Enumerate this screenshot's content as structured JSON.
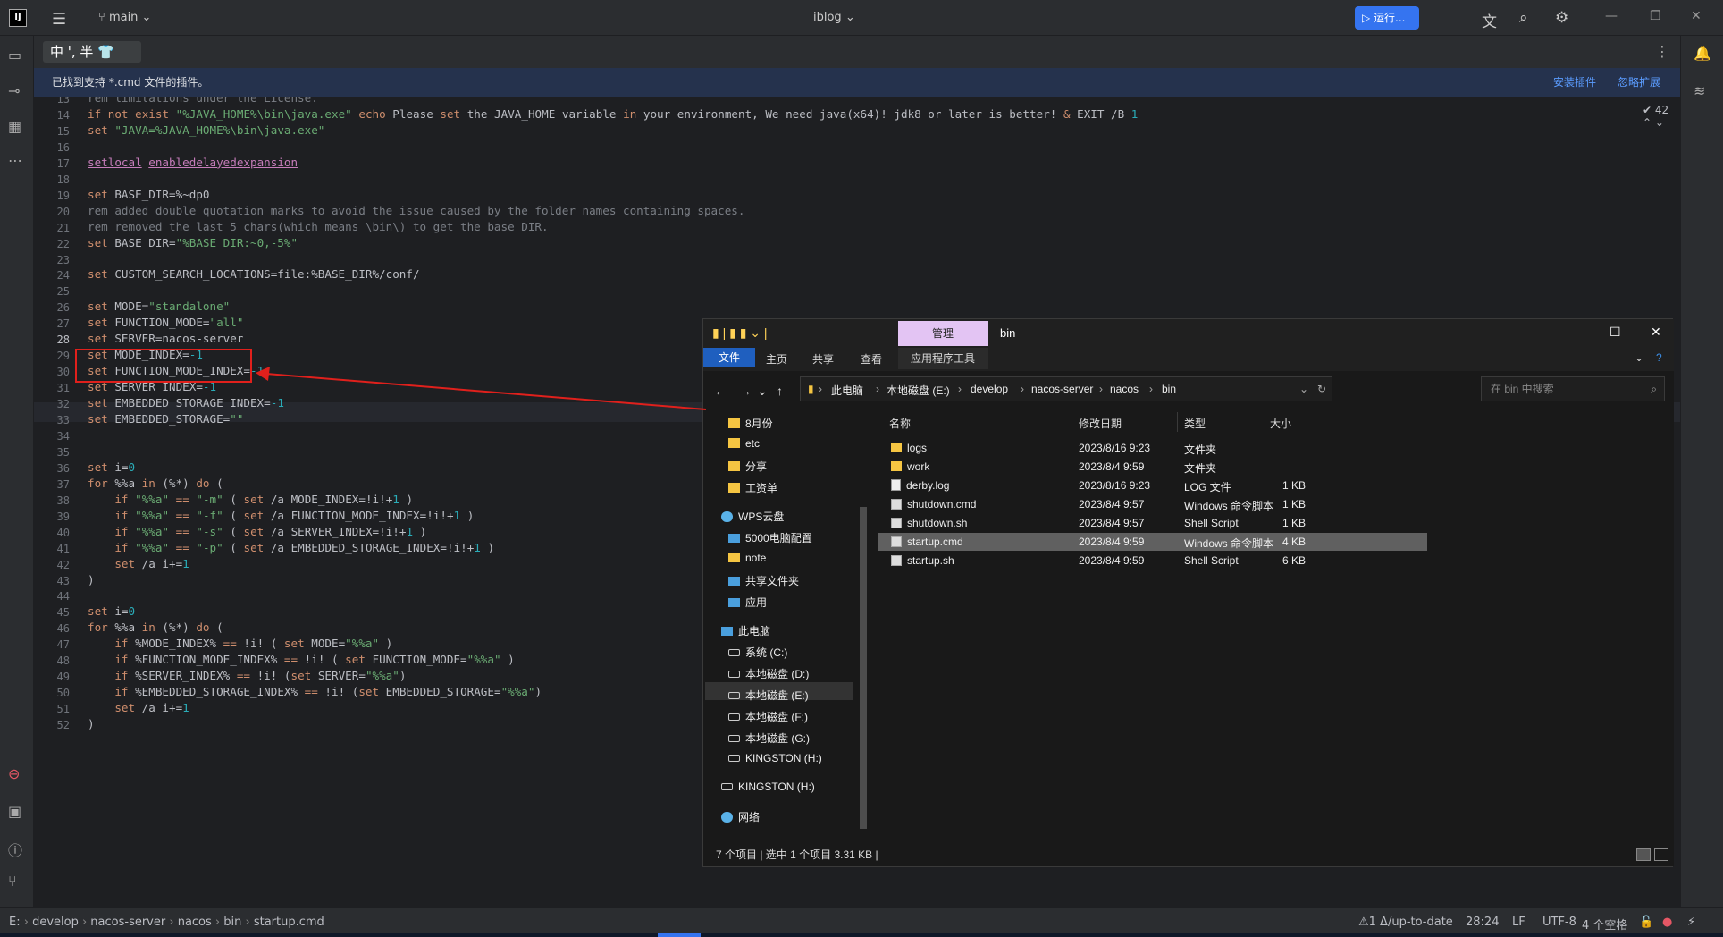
{
  "titlebar": {
    "logo": "IJ",
    "menu_icon": "hamburger-icon",
    "branch": "main",
    "project": "iblog",
    "run_label": "运行...",
    "icons": [
      "translate-icon",
      "search-icon",
      "gear-icon"
    ],
    "window_controls": [
      "minimize-icon",
      "restore-icon",
      "close-icon"
    ]
  },
  "ime": {
    "label": "中 ', 半 👕"
  },
  "banner": {
    "text": "已找到支持 *.cmd 文件的插件。",
    "install": "安装插件",
    "ignore": "忽略扩展"
  },
  "editor": {
    "inspection": "✔ 42",
    "lines": [
      {
        "n": "13",
        "t": "rem limitations under the License."
      },
      {
        "n": "14",
        "t": "if not exist \"%JAVA_HOME%\\bin\\java.exe\" echo Please set the JAVA_HOME variable in your environment, We need java(x64)! jdk8 or later is better! & EXIT /B 1"
      },
      {
        "n": "15",
        "t": "set \"JAVA=%JAVA_HOME%\\bin\\java.exe\""
      },
      {
        "n": "16",
        "t": ""
      },
      {
        "n": "17",
        "t": "setlocal enabledelayedexpansion"
      },
      {
        "n": "18",
        "t": ""
      },
      {
        "n": "19",
        "t": "set BASE_DIR=%~dp0"
      },
      {
        "n": "20",
        "t": "rem added double quotation marks to avoid the issue caused by the folder names containing spaces."
      },
      {
        "n": "21",
        "t": "rem removed the last 5 chars(which means \\bin\\) to get the base DIR."
      },
      {
        "n": "22",
        "t": "set BASE_DIR=\"%BASE_DIR:~0,-5%\""
      },
      {
        "n": "23",
        "t": ""
      },
      {
        "n": "24",
        "t": "set CUSTOM_SEARCH_LOCATIONS=file:%BASE_DIR%/conf/"
      },
      {
        "n": "25",
        "t": ""
      },
      {
        "n": "26",
        "t": "set MODE=\"standalone\""
      },
      {
        "n": "27",
        "t": "set FUNCTION_MODE=\"all\""
      },
      {
        "n": "28",
        "t": "set SERVER=nacos-server"
      },
      {
        "n": "29",
        "t": "set MODE_INDEX=-1"
      },
      {
        "n": "30",
        "t": "set FUNCTION_MODE_INDEX=-1"
      },
      {
        "n": "31",
        "t": "set SERVER_INDEX=-1"
      },
      {
        "n": "32",
        "t": "set EMBEDDED_STORAGE_INDEX=-1"
      },
      {
        "n": "33",
        "t": "set EMBEDDED_STORAGE=\"\""
      },
      {
        "n": "34",
        "t": ""
      },
      {
        "n": "35",
        "t": ""
      },
      {
        "n": "36",
        "t": "set i=0"
      },
      {
        "n": "37",
        "t": "for %%a in (%*) do ("
      },
      {
        "n": "38",
        "t": "    if \"%%a\" == \"-m\" ( set /a MODE_INDEX=!i!+1 )"
      },
      {
        "n": "39",
        "t": "    if \"%%a\" == \"-f\" ( set /a FUNCTION_MODE_INDEX=!i!+1 )"
      },
      {
        "n": "40",
        "t": "    if \"%%a\" == \"-s\" ( set /a SERVER_INDEX=!i!+1 )"
      },
      {
        "n": "41",
        "t": "    if \"%%a\" == \"-p\" ( set /a EMBEDDED_STORAGE_INDEX=!i!+1 )"
      },
      {
        "n": "42",
        "t": "    set /a i+=1"
      },
      {
        "n": "43",
        "t": ")"
      },
      {
        "n": "44",
        "t": ""
      },
      {
        "n": "45",
        "t": "set i=0"
      },
      {
        "n": "46",
        "t": "for %%a in (%*) do ("
      },
      {
        "n": "47",
        "t": "    if %MODE_INDEX% == !i! ( set MODE=\"%%a\" )"
      },
      {
        "n": "48",
        "t": "    if %FUNCTION_MODE_INDEX% == !i! ( set FUNCTION_MODE=\"%%a\" )"
      },
      {
        "n": "49",
        "t": "    if %SERVER_INDEX% == !i! (set SERVER=\"%%a\")"
      },
      {
        "n": "50",
        "t": "    if %EMBEDDED_STORAGE_INDEX% == !i! (set EMBEDDED_STORAGE=\"%%a\")"
      },
      {
        "n": "51",
        "t": "    set /a i+=1"
      },
      {
        "n": "52",
        "t": ")"
      }
    ]
  },
  "explorer": {
    "quick_access_icons": [
      "folder-icon",
      "properties-icon",
      "folder-icon",
      "dropdown-icon"
    ],
    "manage_tab": "管理",
    "title": "bin",
    "ribbon_tabs": [
      "文件",
      "主页",
      "共享",
      "查看"
    ],
    "app_tools": "应用程序工具",
    "breadcrumbs": [
      "此电脑",
      "本地磁盘 (E:)",
      "develop",
      "nacos-server",
      "nacos",
      "bin"
    ],
    "search_placeholder": "在 bin 中搜索",
    "nav": [
      {
        "label": "8月份",
        "icon": "folder"
      },
      {
        "label": "etc",
        "icon": "folder"
      },
      {
        "label": "分享",
        "icon": "folder"
      },
      {
        "label": "工资单",
        "icon": "folder"
      },
      {
        "label": "WPS云盘",
        "icon": "cloud"
      },
      {
        "label": "5000电脑配置",
        "icon": "people"
      },
      {
        "label": "note",
        "icon": "folder"
      },
      {
        "label": "共享文件夹",
        "icon": "people"
      },
      {
        "label": "应用",
        "icon": "people"
      },
      {
        "label": "此电脑",
        "icon": "pc"
      },
      {
        "label": "系统 (C:)",
        "icon": "drive"
      },
      {
        "label": "本地磁盘 (D:)",
        "icon": "drive"
      },
      {
        "label": "本地磁盘 (E:)",
        "icon": "drive"
      },
      {
        "label": "本地磁盘 (F:)",
        "icon": "drive"
      },
      {
        "label": "本地磁盘 (G:)",
        "icon": "drive"
      },
      {
        "label": "KINGSTON (H:)",
        "icon": "drive"
      },
      {
        "label": "KINGSTON (H:)",
        "icon": "drive"
      },
      {
        "label": "网络",
        "icon": "network"
      }
    ],
    "columns": [
      "名称",
      "修改日期",
      "类型",
      "大小"
    ],
    "files": [
      {
        "name": "logs",
        "date": "2023/8/16 9:23",
        "type": "文件夹",
        "size": "",
        "icon": "folder"
      },
      {
        "name": "work",
        "date": "2023/8/4 9:59",
        "type": "文件夹",
        "size": "",
        "icon": "folder"
      },
      {
        "name": "derby.log",
        "date": "2023/8/16 9:23",
        "type": "LOG 文件",
        "size": "1 KB",
        "icon": "log"
      },
      {
        "name": "shutdown.cmd",
        "date": "2023/8/4 9:57",
        "type": "Windows 命令脚本",
        "size": "1 KB",
        "icon": "cmd"
      },
      {
        "name": "shutdown.sh",
        "date": "2023/8/4 9:57",
        "type": "Shell Script",
        "size": "1 KB",
        "icon": "cmd"
      },
      {
        "name": "startup.cmd",
        "date": "2023/8/4 9:59",
        "type": "Windows 命令脚本",
        "size": "4 KB",
        "icon": "cmd"
      },
      {
        "name": "startup.sh",
        "date": "2023/8/4 9:59",
        "type": "Shell Script",
        "size": "6 KB",
        "icon": "cmd"
      }
    ],
    "status": "7 个项目  |  选中 1 个项目  3.31 KB  |"
  },
  "statusbar": {
    "breadcrumbs": [
      "E:",
      "develop",
      "nacos-server",
      "nacos",
      "bin",
      "startup.cmd"
    ],
    "vcs": "⚠1 Δ/up-to-date",
    "position": "28:24",
    "line_sep": "LF",
    "encoding": "UTF-8",
    "indent": "4 个空格"
  }
}
